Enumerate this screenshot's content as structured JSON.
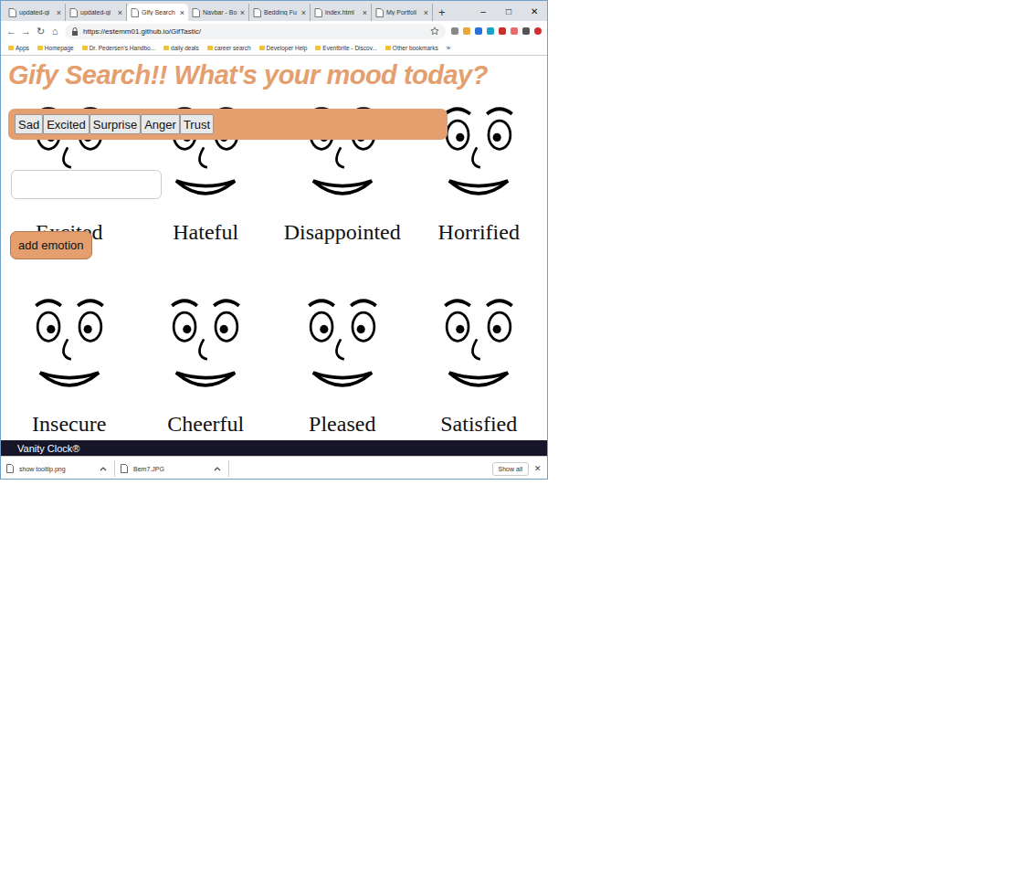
{
  "window": {
    "controls": [
      "–",
      "□",
      "✕"
    ]
  },
  "tabs": [
    {
      "label": "updated-gi",
      "selected": false
    },
    {
      "label": "updated-gi",
      "selected": false
    },
    {
      "label": "Gify Search",
      "selected": true
    },
    {
      "label": "Navbar - Bo",
      "selected": false
    },
    {
      "label": "Bedding Fu",
      "selected": false
    },
    {
      "label": "index.html",
      "selected": false
    },
    {
      "label": "My Portfoli",
      "selected": false
    }
  ],
  "tab_close": "×",
  "new_tab": "+",
  "nav": [
    "←",
    "→",
    "↻",
    "⌂"
  ],
  "address": "https://estemm01.github.io/GifTastic/",
  "bookmarks": [
    "Apps",
    "Homepage",
    "Dr. Pedersen's Handbo...",
    "daily deals",
    "career search",
    "Developer Help",
    "Eventbrite - Discov...",
    "Other bookmarks"
  ],
  "bookmarks_more": "»",
  "page": {
    "title": "Gify Search!! What's your mood today?",
    "emotions": [
      "Sad",
      "Excited",
      "Surprise",
      "Anger",
      "Trust"
    ],
    "input_value": "",
    "add_button": "add emotion",
    "faces": [
      "Excited",
      "Hateful",
      "Disappointed",
      "Horrified",
      "Insecure",
      "Cheerful",
      "Pleased",
      "Satisfied"
    ],
    "footer": "Vanity Clock®"
  },
  "downloads": {
    "items": [
      "show tooltip.png",
      "Bem7.JPG"
    ],
    "show_all": "Show all",
    "close": "✕"
  }
}
